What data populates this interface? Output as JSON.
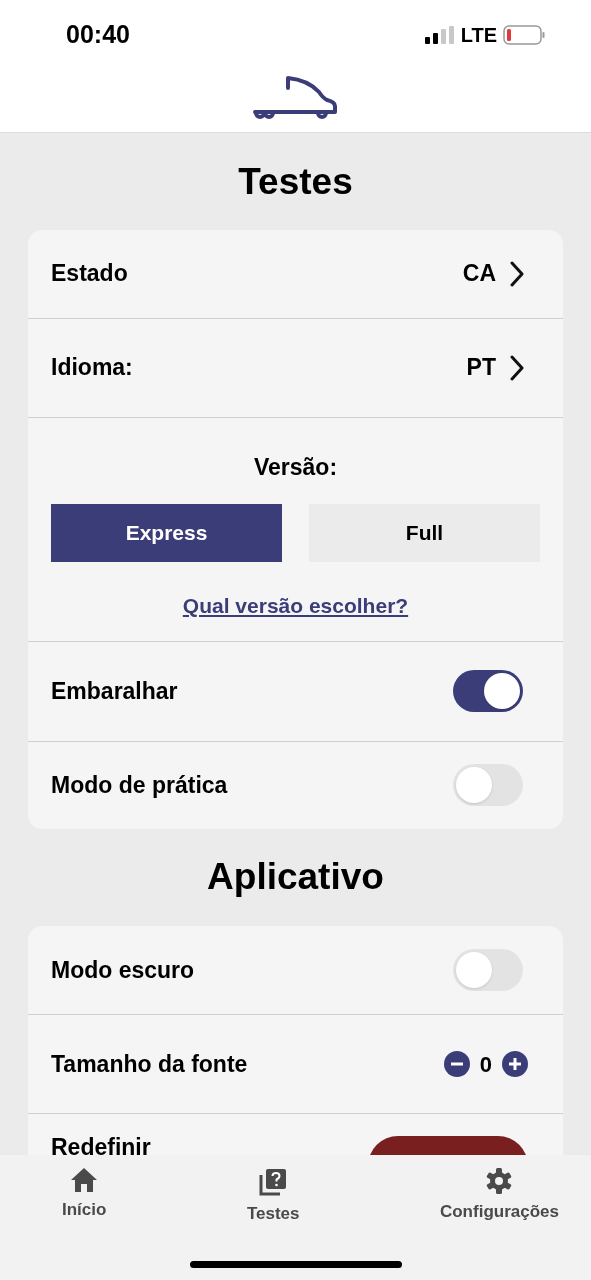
{
  "status_bar": {
    "time": "00:40",
    "network": "LTE"
  },
  "sections": [
    {
      "title": "Testes",
      "rows": [
        {
          "kind": "select",
          "label": "Estado",
          "value": "CA"
        },
        {
          "kind": "select",
          "label": "Idioma:",
          "value": "PT"
        },
        {
          "kind": "version",
          "label": "Versão:",
          "options": [
            {
              "label": "Express",
              "selected": true
            },
            {
              "label": "Full",
              "selected": false
            }
          ],
          "link": "Qual versão escolher?"
        },
        {
          "kind": "toggle",
          "label": "Embaralhar",
          "on": true
        },
        {
          "kind": "toggle",
          "label": "Modo de prática",
          "on": false
        }
      ]
    },
    {
      "title": "Aplicativo",
      "rows": [
        {
          "kind": "toggle",
          "label": "Modo escuro",
          "on": false
        },
        {
          "kind": "stepper",
          "label": "Tamanho da fonte",
          "value": "0"
        },
        {
          "kind": "action",
          "label": "Redefinir"
        }
      ]
    }
  ],
  "tab_bar": [
    {
      "label": "Início",
      "kind": "home"
    },
    {
      "label": "Testes",
      "kind": "quiz"
    },
    {
      "label": "Configurações",
      "kind": "settings"
    }
  ]
}
